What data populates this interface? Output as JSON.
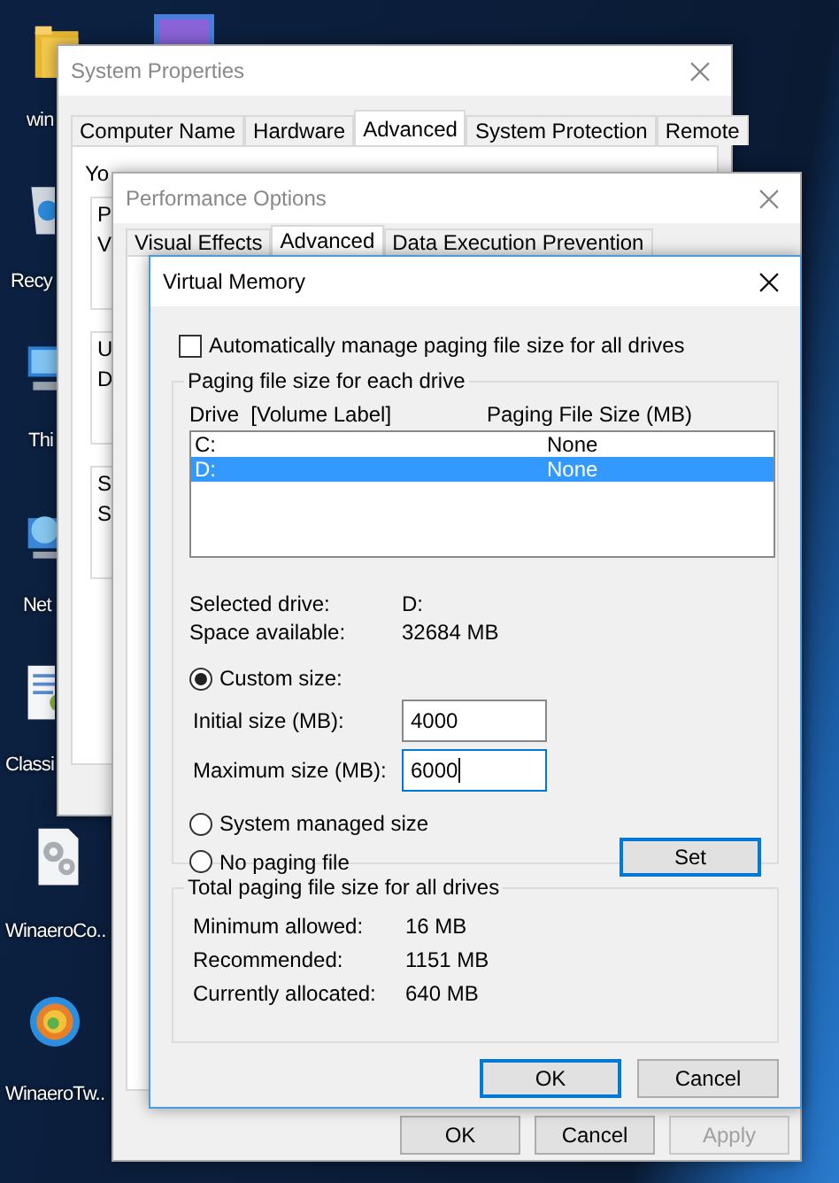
{
  "desktop": {
    "icons": [
      {
        "label": "win"
      },
      {
        "label": "Recy"
      },
      {
        "label": "Thi"
      },
      {
        "label": "Net"
      },
      {
        "label": "Classi"
      },
      {
        "label": "WinaeroCo.."
      },
      {
        "label": "WinaeroTw.."
      }
    ]
  },
  "system_properties": {
    "title": "System Properties",
    "active": false,
    "tabs": [
      {
        "label": "Computer Name",
        "selected": false
      },
      {
        "label": "Hardware",
        "selected": false
      },
      {
        "label": "Advanced",
        "selected": true
      },
      {
        "label": "System Protection",
        "selected": false
      },
      {
        "label": "Remote",
        "selected": false
      }
    ],
    "intro": "Yo",
    "groups": [
      {
        "lines": [
          "P",
          "V"
        ]
      },
      {
        "lines": [
          "U",
          "D"
        ]
      },
      {
        "lines": [
          "S",
          "S"
        ]
      }
    ]
  },
  "performance_options": {
    "title": "Performance Options",
    "active": false,
    "tabs": [
      {
        "label": "Visual Effects",
        "selected": false
      },
      {
        "label": "Advanced",
        "selected": true
      },
      {
        "label": "Data Execution Prevention",
        "selected": false
      }
    ],
    "buttons": [
      {
        "label": "OK",
        "disabled": false
      },
      {
        "label": "Cancel",
        "disabled": false
      },
      {
        "label": "Apply",
        "disabled": true
      }
    ]
  },
  "virtual_memory": {
    "title": "Virtual Memory",
    "active": true,
    "auto_manage": {
      "label": "Automatically manage paging file size for all drives",
      "checked": false
    },
    "drives_group": {
      "title": "Paging file size for each drive",
      "columns": [
        "Drive  [Volume Label]",
        "Paging File Size (MB)"
      ],
      "rows": [
        {
          "drive": "C:",
          "size": "None",
          "selected": false
        },
        {
          "drive": "D:",
          "size": "None",
          "selected": true
        }
      ],
      "info": [
        {
          "label": "Selected drive:",
          "value": "D:"
        },
        {
          "label": "Space available:",
          "value": "32684 MB"
        }
      ],
      "custom_size": {
        "label": "Custom size:",
        "selected": true
      },
      "fields": [
        {
          "label": "Initial size (MB):",
          "value": "4000",
          "focused": false
        },
        {
          "label": "Maximum size (MB):",
          "value": "6000",
          "focused": true
        }
      ],
      "system_managed": {
        "label": "System managed size",
        "selected": false
      },
      "no_paging": {
        "label": "No paging file",
        "selected": false
      },
      "set_button": {
        "label": "Set",
        "default": true
      }
    },
    "totals_group": {
      "title": "Total paging file size for all drives",
      "rows": [
        {
          "label": "Minimum allowed:",
          "value": "16 MB"
        },
        {
          "label": "Recommended:",
          "value": "1151 MB"
        },
        {
          "label": "Currently allocated:",
          "value": "640 MB"
        }
      ]
    },
    "buttons": [
      {
        "label": "OK",
        "default": true
      },
      {
        "label": "Cancel",
        "default": false
      }
    ]
  }
}
